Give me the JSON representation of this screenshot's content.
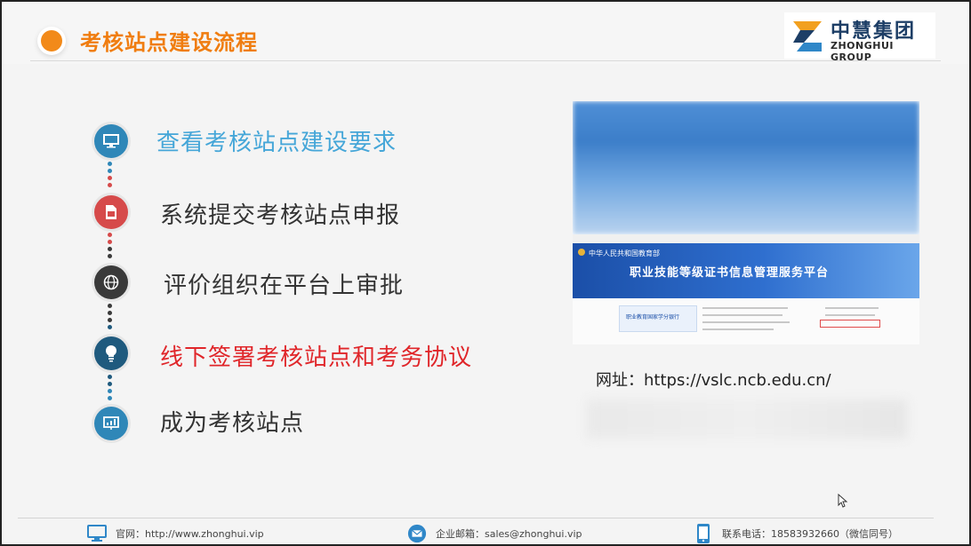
{
  "header": {
    "title": "考核站点建设流程",
    "accent_color": "#f07d10"
  },
  "logo": {
    "cn_text": "中慧集团",
    "en_text": "ZHONGHUI GROUP"
  },
  "steps": [
    {
      "label": "查看考核站点建设要求",
      "icon": "monitor-icon",
      "color": "#45a6d8",
      "icon_bg": "#2f87b8"
    },
    {
      "label": "系统提交考核站点申报",
      "icon": "sim-card-icon",
      "color": "#333333",
      "icon_bg": "#d64a4a"
    },
    {
      "label": "评价组织在平台上审批",
      "icon": "globe-icon",
      "color": "#333333",
      "icon_bg": "#3a3a3a"
    },
    {
      "label": "线下签署考核站点和考务协议",
      "icon": "lightbulb-icon",
      "color": "#e0262a",
      "icon_bg": "#1f5a7e"
    },
    {
      "label": "成为考核站点",
      "icon": "presentation-icon",
      "color": "#333333",
      "icon_bg": "#2f87b8"
    }
  ],
  "screenshot": {
    "ministry": "中华人民共和国教育部",
    "platform": "职业技能等级证书信息管理服务平台",
    "card_text": "职业教育国家学分银行"
  },
  "url": {
    "label": "网址：",
    "value": "https://vslc.ncb.edu.cn/"
  },
  "footer": {
    "website_label": "官网：",
    "website_value": "http://www.zhonghui.vip",
    "email_label": "企业邮箱：",
    "email_value": "sales@zhonghui.vip",
    "phone_label": "联系电话：",
    "phone_value": "18583932660（微信同号）"
  }
}
